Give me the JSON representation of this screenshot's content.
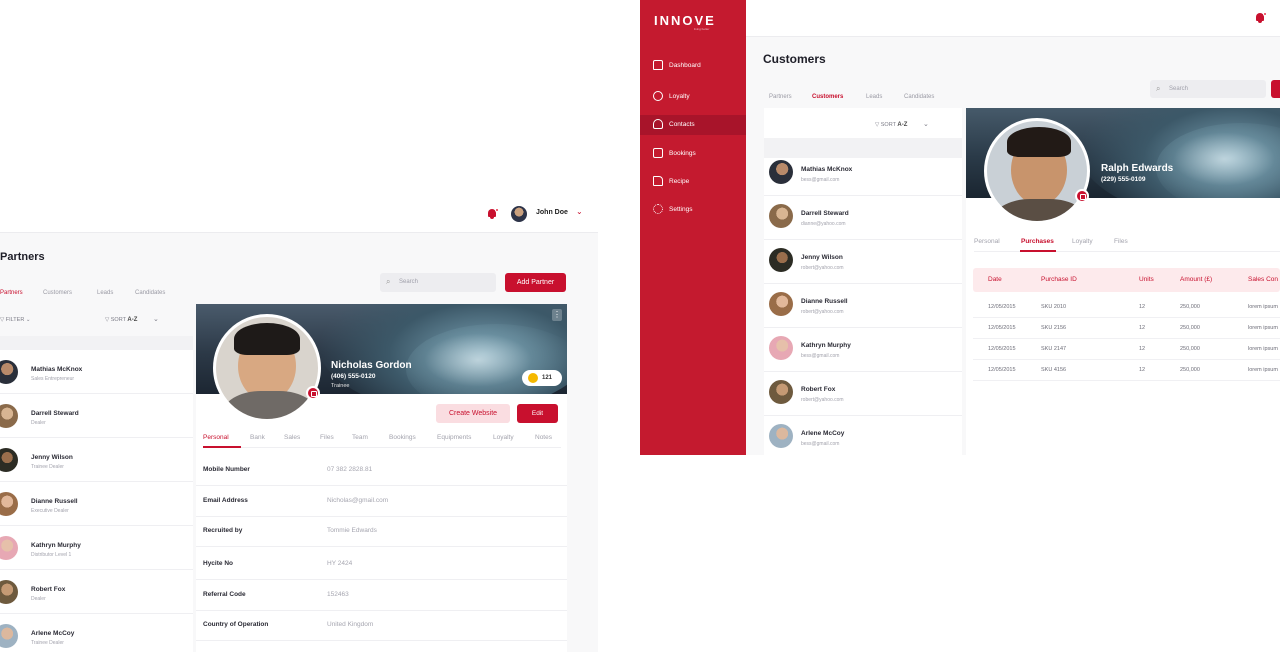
{
  "partners_screen": {
    "header": {
      "user_name": "John Doe",
      "bell_icon": "bell-icon",
      "dropdown_icon": "chevron-down-icon"
    },
    "title": "Partners",
    "search": {
      "placeholder": "Search"
    },
    "add_button": "Add Partner",
    "tabs": [
      "Partners",
      "Customers",
      "Leads",
      "Candidates"
    ],
    "active_tab": "Partners",
    "filter_label": "FILTER",
    "sort_label": "SORT",
    "sort_value": "A-Z",
    "list": [
      {
        "name": "Mathias  McKnox",
        "sub": "Sales Entrepreneur"
      },
      {
        "name": "Darrell Steward",
        "sub": "Dealer"
      },
      {
        "name": "Jenny Wilson",
        "sub": "Trainee Dealer"
      },
      {
        "name": "Dianne Russell",
        "sub": "Executive Dealer"
      },
      {
        "name": "Kathryn Murphy",
        "sub": "Distributor Level 1"
      },
      {
        "name": "Robert Fox",
        "sub": "Dealer"
      },
      {
        "name": "Arlene McCoy",
        "sub": "Trainee Dealer"
      }
    ],
    "profile": {
      "name": "Nicholas Gordon",
      "phone": "(406) 555-0120",
      "role": "Trainee",
      "points": "121",
      "create_website": "Create Website",
      "edit": "Edit",
      "tabs": [
        "Personal",
        "Bank",
        "Sales",
        "Files",
        "Team",
        "Bookings",
        "Equipments",
        "Loyalty",
        "Notes"
      ],
      "active_tab": "Personal",
      "fields": [
        {
          "label": "Mobile Number",
          "value": "07 382 2828.81"
        },
        {
          "label": "Email Address",
          "value": "Nicholas@gmail.com"
        },
        {
          "label": "Recruited by",
          "value": "Tommie Edwards"
        },
        {
          "label": "Hycite No",
          "value": "HY 2424"
        },
        {
          "label": "Referral Code",
          "value": "152463"
        },
        {
          "label": "Country of Operation",
          "value": "United Kingdom"
        }
      ]
    }
  },
  "customers_screen": {
    "logo": "INNOVE",
    "logo_sub": "living better",
    "nav": [
      {
        "label": "Dashboard",
        "icon": "home-icon"
      },
      {
        "label": "Loyalty",
        "icon": "award-icon"
      },
      {
        "label": "Contacts",
        "icon": "user-plus-icon"
      },
      {
        "label": "Bookings",
        "icon": "calendar-icon"
      },
      {
        "label": "Recipe",
        "icon": "document-icon"
      },
      {
        "label": "Settings",
        "icon": "gear-icon"
      }
    ],
    "active_nav": "Contacts",
    "title": "Customers",
    "search": {
      "placeholder": "Search"
    },
    "tabs": [
      "Partners",
      "Customers",
      "Leads",
      "Candidates"
    ],
    "active_tab": "Customers",
    "sort_label": "SORT",
    "sort_value": "A-Z",
    "list": [
      {
        "name": "Mathias  McKnox",
        "sub": "bess@gmail.com"
      },
      {
        "name": "Darrell Steward",
        "sub": "dianne@yahoo.com"
      },
      {
        "name": "Jenny Wilson",
        "sub": "robert@yahoo.com"
      },
      {
        "name": "Dianne Russell",
        "sub": "robert@yahoo.com"
      },
      {
        "name": "Kathryn Murphy",
        "sub": "bess@gmail.com"
      },
      {
        "name": "Robert Fox",
        "sub": "robert@yahoo.com"
      },
      {
        "name": "Arlene McCoy",
        "sub": "bess@gmail.com"
      }
    ],
    "profile": {
      "name": "Ralph Edwards",
      "phone": "(229) 555-0109",
      "tabs": [
        "Personal",
        "Purchases",
        "Loyalty",
        "Files"
      ],
      "active_tab": "Purchases",
      "table": {
        "columns": [
          "Date",
          "Purchase ID",
          "Units",
          "Amount (£)",
          "Sales Con"
        ],
        "rows": [
          [
            "12/05/2015",
            "SKU 2010",
            "12",
            "250,000",
            "lorem ipsum"
          ],
          [
            "12/05/2015",
            "SKU 2156",
            "12",
            "250,000",
            "lorem ipsum"
          ],
          [
            "12/05/2015",
            "SKU 2147",
            "12",
            "250,000",
            "lorem ipsum"
          ],
          [
            "12/05/2015",
            "SKU 4156",
            "12",
            "250,000",
            "lorem ipsum"
          ]
        ]
      }
    }
  },
  "colors": {
    "brand": "#c8102e",
    "sidebar": "#c41a2f",
    "sidebar_active": "#a8142a",
    "coin": "#f5b800"
  }
}
